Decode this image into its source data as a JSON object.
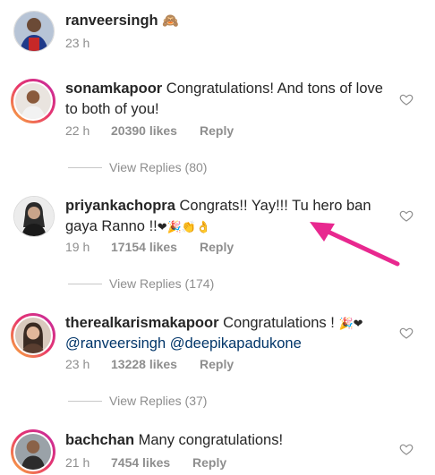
{
  "post": {
    "username": "ranveersingh",
    "emoji": "🙈",
    "time": "23 h"
  },
  "comments": [
    {
      "username": "sonamkapoor",
      "text": "Congratulations! And tons of love to both of you!",
      "time": "22 h",
      "likes": "20390 likes",
      "reply": "Reply",
      "view_replies": "View Replies (80)"
    },
    {
      "username": "priyankachopra",
      "text": "Congrats!! Yay!!! Tu hero ban gaya Ranno !!",
      "emojis": "❤🎉👏👌",
      "time": "19 h",
      "likes": "17154 likes",
      "reply": "Reply",
      "view_replies": "View Replies (174)"
    },
    {
      "username": "therealkarismakapoor",
      "text": "Congratulations !",
      "emojis": "🎉❤",
      "mention1": "@ranveersingh",
      "mention2": "@deepikapadukone",
      "time": "23 h",
      "likes": "13228 likes",
      "reply": "Reply",
      "view_replies": "View Replies (37)"
    },
    {
      "username": "bachchan",
      "text": "Many congratulations!",
      "time": "21 h",
      "likes": "7454 likes",
      "reply": "Reply"
    }
  ],
  "colors": {
    "arrow": "#e8288f",
    "mention": "#003569",
    "meta": "#8e8e8e"
  }
}
